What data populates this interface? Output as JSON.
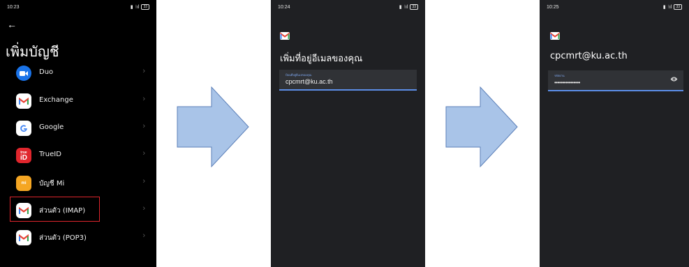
{
  "screen1": {
    "status": {
      "time": "10:23",
      "battery": "33"
    },
    "title": "เพิ่มบัญชี",
    "items": [
      {
        "label": "Duo",
        "icon": "duo-icon"
      },
      {
        "label": "Exchange",
        "icon": "gmail-icon"
      },
      {
        "label": "Google",
        "icon": "google-icon"
      },
      {
        "label": "TrueID",
        "icon": "trueid-icon"
      },
      {
        "label": "บัญชี Mi",
        "icon": "mi-icon"
      },
      {
        "label": "ส่วนตัว (IMAP)",
        "icon": "gmail-icon"
      },
      {
        "label": "ส่วนตัว (POP3)",
        "icon": "gmail-icon"
      }
    ],
    "trueid_logo_text": "true",
    "trueid_logo_big": "iD",
    "mi_logo_text": "mi"
  },
  "screen2": {
    "status": {
      "time": "10:24",
      "battery": "33"
    },
    "title": "เพิ่มที่อยู่อีเมลของคุณ",
    "email_field_label": "ป้อนที่อยู่อีเมลของคุณ",
    "email_value": "cpcmrt@ku.ac.th"
  },
  "screen3": {
    "status": {
      "time": "10:25",
      "battery": "33"
    },
    "title": "cpcmrt@ku.ac.th",
    "password_field_label": "รหัสผ่าน",
    "password_value": "••••••••••••••••"
  },
  "colors": {
    "arrow_fill": "#a9c4e8",
    "arrow_stroke": "#5b7fb8",
    "highlight": "#e0262d",
    "field_underline": "#5c8ee8"
  }
}
